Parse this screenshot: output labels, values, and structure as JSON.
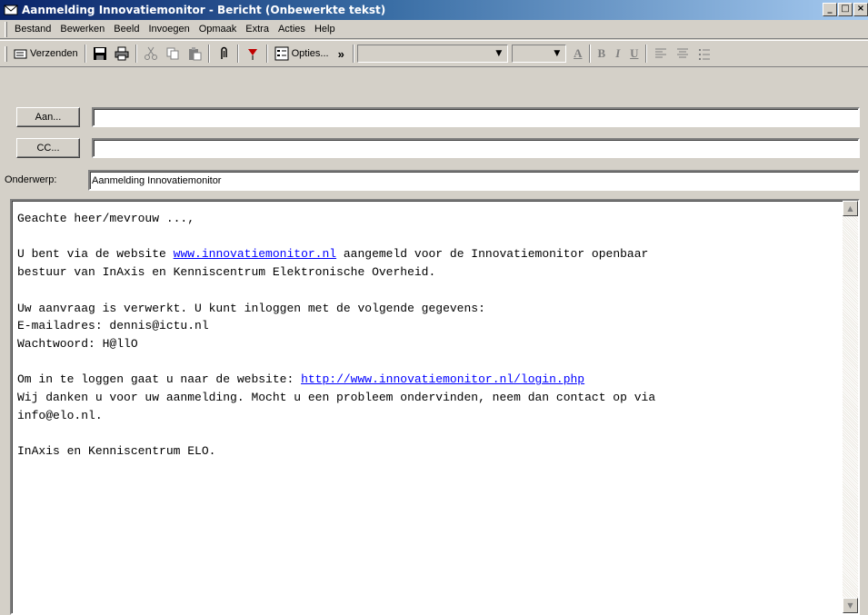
{
  "window": {
    "title": "Aanmelding Innovatiemonitor - Bericht (Onbewerkte tekst)",
    "min_label": "_",
    "max_label": "□",
    "close_label": "×"
  },
  "menu": {
    "items": [
      "Bestand",
      "Bewerken",
      "Beeld",
      "Invoegen",
      "Opmaak",
      "Extra",
      "Acties",
      "Help"
    ]
  },
  "toolbar": {
    "send_label": "Verzenden",
    "options_label": "Opties...",
    "more_label": "»",
    "bold_label": "B",
    "italic_label": "I",
    "underline_label": "U",
    "font_color_label": "A"
  },
  "address": {
    "to_button": "Aan...",
    "to_value": "",
    "cc_button": "CC...",
    "cc_value": "",
    "subject_label": "Onderwerp:",
    "subject_value": "Aanmelding Innovatiemonitor"
  },
  "body": {
    "greeting": "Geachte heer/mevrouw ...,",
    "p1_before": "U bent via de website ",
    "p1_link": "www.innovatiemonitor.nl",
    "p1_after": " aangemeld voor de Innovatiemonitor openbaar",
    "p1_line2": "bestuur van InAxis en Kenniscentrum Elektronische Overheid.",
    "p2_line1": "Uw aanvraag is verwerkt. U kunt inloggen met de volgende gegevens:",
    "p2_line2": "E-mailadres: dennis@ictu.nl",
    "p2_line3": "Wachtwoord: H@llO",
    "p3_before": "Om in te loggen gaat u naar de website: ",
    "p3_link": "http://www.innovatiemonitor.nl/login.php",
    "p3_line2": "Wij danken u voor uw aanmelding. Mocht u een probleem ondervinden, neem dan contact op via",
    "p3_line3": "info@elo.nl.",
    "signature": "InAxis en Kenniscentrum ELO."
  },
  "colors": {
    "titlebar_start": "#0a246a",
    "titlebar_end": "#a6caf0",
    "link": "#0000ff",
    "chrome": "#d4d0c8"
  }
}
